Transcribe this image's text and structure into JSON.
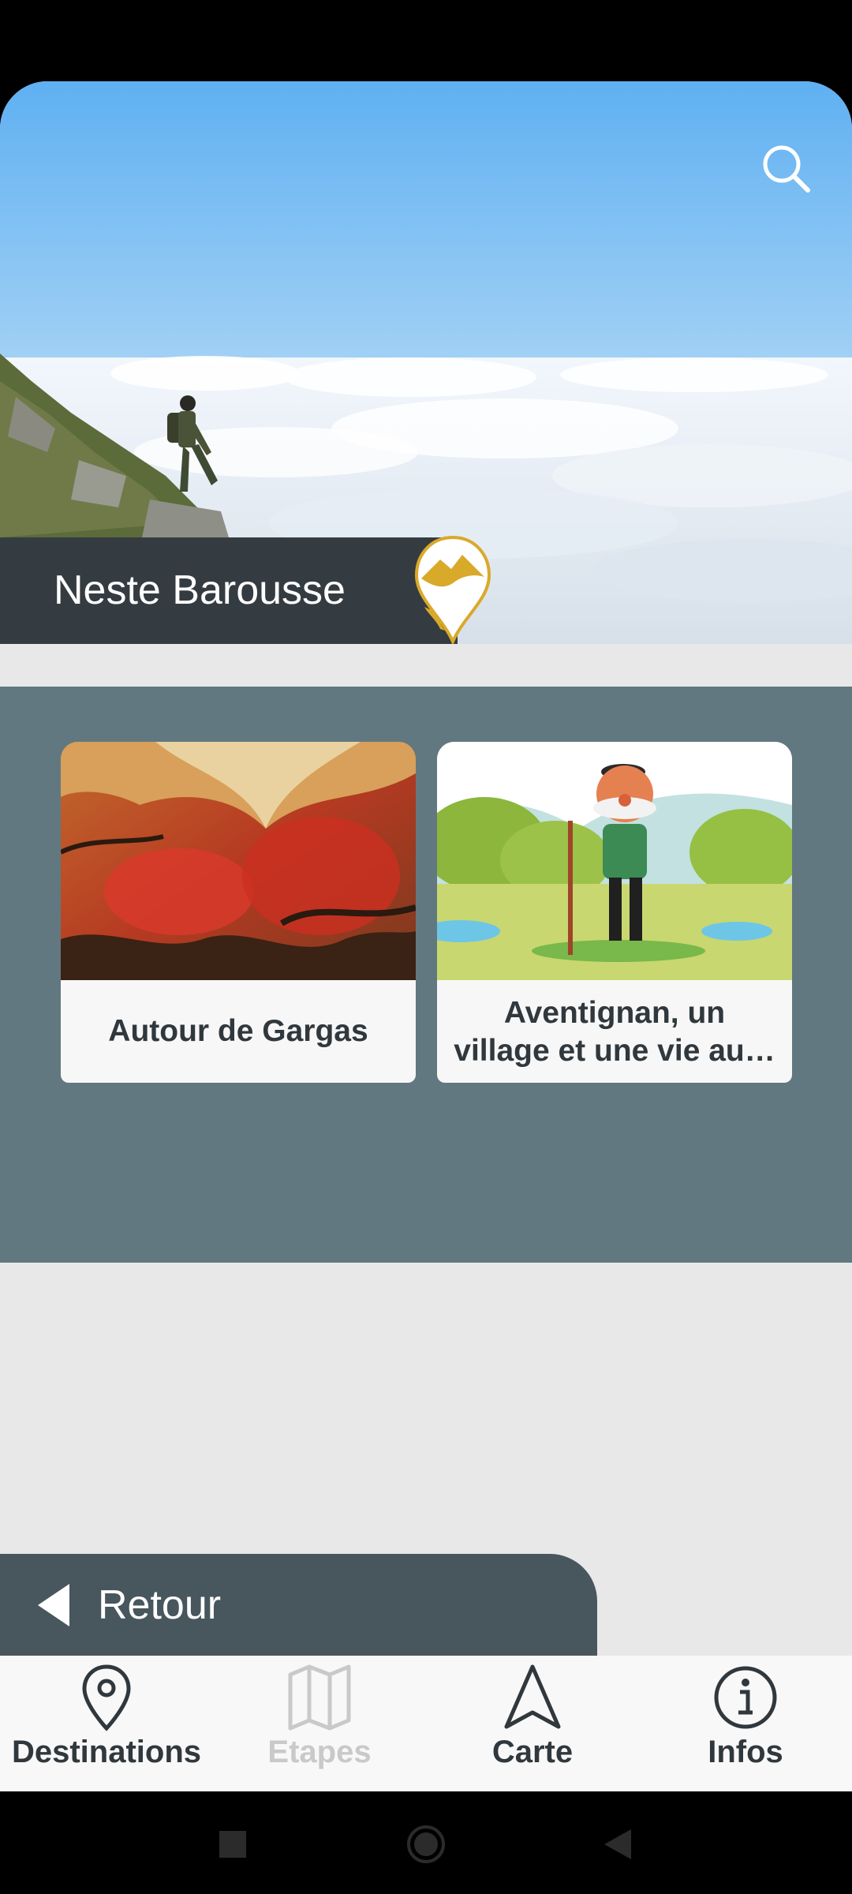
{
  "hero": {
    "title": "Neste Barousse",
    "search_icon": "search-icon",
    "logo_icon": "mountain-pin-logo-icon"
  },
  "cards": [
    {
      "label": "Autour de Gargas",
      "image": "cave-painting-image"
    },
    {
      "label": "Aventignan, un village et une vie au…",
      "image": "cartoon-old-man-image"
    }
  ],
  "back": {
    "label": "Retour",
    "icon": "back-triangle-icon"
  },
  "nav": {
    "destinations": "Destinations",
    "etapes": "Etapes",
    "carte": "Carte",
    "infos": "Infos"
  },
  "colors": {
    "banner": "#353c41",
    "section": "#627880",
    "back_tab": "#48565d",
    "text_dark": "#30383d",
    "disabled": "#c9c9c9",
    "accent_gold": "#d9a92a"
  }
}
